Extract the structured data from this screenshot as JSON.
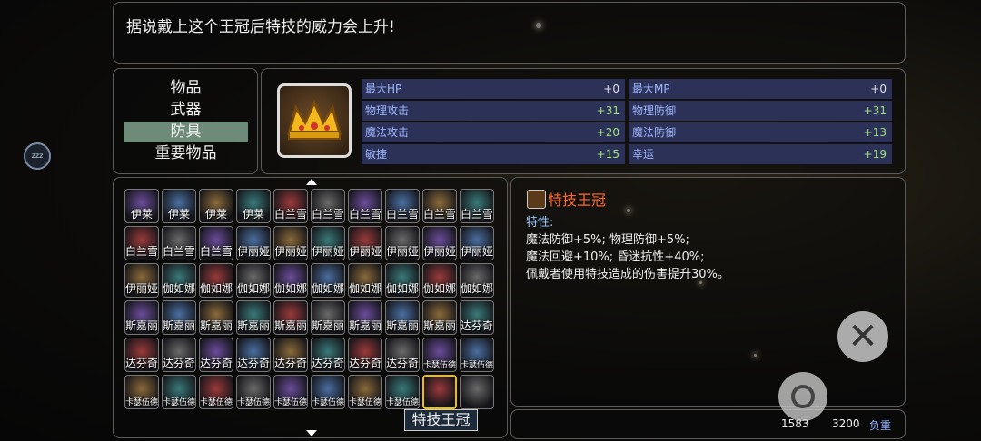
{
  "message": "据说戴上这个王冠后特技的威力会上升!",
  "categories": [
    "物品",
    "武器",
    "防具",
    "重要物品"
  ],
  "selected_category": 2,
  "stats": [
    {
      "label": "最大HP",
      "value": "+0"
    },
    {
      "label": "最大MP",
      "value": "+0"
    },
    {
      "label": "物理攻击",
      "value": "+31"
    },
    {
      "label": "物理防御",
      "value": "+31"
    },
    {
      "label": "魔法攻击",
      "value": "+20"
    },
    {
      "label": "魔法防御",
      "value": "+13"
    },
    {
      "label": "敏捷",
      "value": "+15"
    },
    {
      "label": "幸运",
      "value": "+19"
    }
  ],
  "items": [
    "伊莱",
    "伊莱",
    "伊莱",
    "伊莱",
    "白兰雪",
    "白兰雪",
    "白兰雪",
    "白兰雪",
    "白兰雪",
    "白兰雪",
    "白兰雪",
    "白兰雪",
    "白兰雪",
    "伊丽娅",
    "伊丽娅",
    "伊丽娅",
    "伊丽娅",
    "伊丽娅",
    "伊丽娅",
    "伊丽娅",
    "伊丽娅",
    "伽如娜",
    "伽如娜",
    "伽如娜",
    "伽如娜",
    "伽如娜",
    "伽如娜",
    "伽如娜",
    "伽如娜",
    "伽如娜",
    "斯嘉丽",
    "斯嘉丽",
    "斯嘉丽",
    "斯嘉丽",
    "斯嘉丽",
    "斯嘉丽",
    "斯嘉丽",
    "斯嘉丽",
    "斯嘉丽",
    "达芬奇",
    "达芬奇",
    "达芬奇",
    "达芬奇",
    "达芬奇",
    "达芬奇",
    "达芬奇",
    "达芬奇",
    "达芬奇",
    "卡瑟伍德",
    "卡瑟伍德",
    "卡瑟伍德",
    "卡瑟伍德",
    "卡瑟伍德",
    "卡瑟伍德",
    "卡瑟伍德",
    "卡瑟伍德",
    "卡瑟伍德",
    "卡瑟伍德",
    "",
    "",
    ""
  ],
  "selected_item_index": 58,
  "tooltip": "特技王冠",
  "detail": {
    "title": "特技王冠",
    "heading": "特性:",
    "lines": [
      "魔法防御+5%; 物理防御+5%;",
      "魔法回避+10%; 昏迷抗性+40%;",
      "佩戴者使用特技造成的伤害提升30%。"
    ]
  },
  "weight": {
    "current": "1583",
    "max": "3200",
    "label": "负重"
  },
  "sleep_button": "zzz",
  "close_icon": "close-icon"
}
